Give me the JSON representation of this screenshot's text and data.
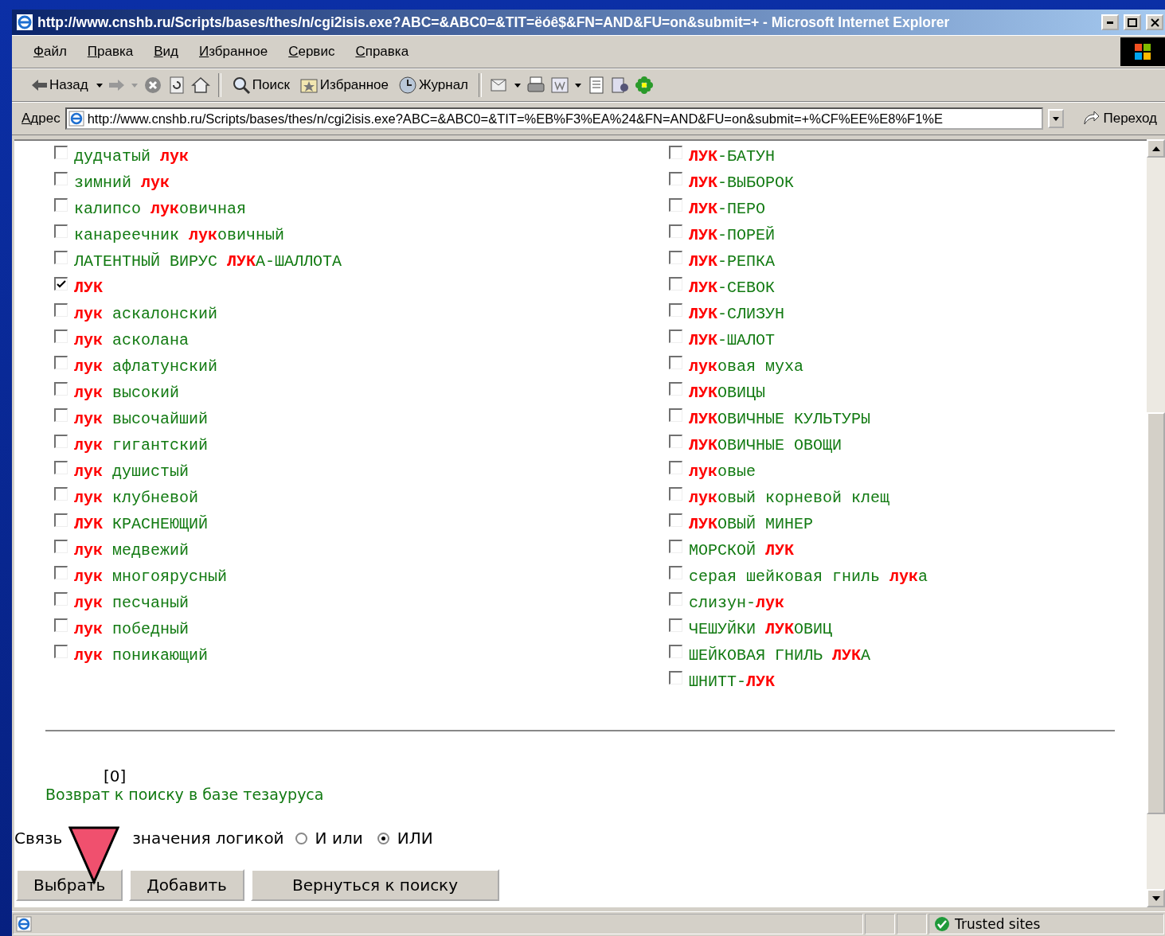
{
  "window": {
    "title": "http://www.cnshb.ru/Scripts/bases/thes/n/cgi2isis.exe?ABC=&ABC0=&TIT=ëóê$&FN=AND&FU=on&submit=+ - Microsoft Internet Explorer"
  },
  "menu": [
    "Файл",
    "Правка",
    "Вид",
    "Избранное",
    "Сервис",
    "Справка"
  ],
  "toolbar": {
    "back": "Назад",
    "buttons": [
      {
        "kind": "search",
        "label": "Поиск"
      },
      {
        "kind": "favorites",
        "label": "Избранное"
      },
      {
        "kind": "history",
        "label": "Журнал"
      }
    ]
  },
  "address": {
    "label": "Адрес",
    "url": "http://www.cnshb.ru/Scripts/bases/thes/n/cgi2isis.exe?ABC=&ABC0=&TIT=%EB%F3%EA%24&FN=AND&FU=on&submit=+%CF%EE%E8%F1%E",
    "go": "Переход"
  },
  "terms": {
    "columns": [
      [
        {
          "text": "дудчатый **лук**",
          "checked": false
        },
        {
          "text": "зимний **лук**",
          "checked": false
        },
        {
          "text": "калипсо **лук**овичная",
          "checked": false
        },
        {
          "text": "канареечник **лук**овичный",
          "checked": false
        },
        {
          "text": "ЛАТЕНТНЫЙ ВИРУС **ЛУК**А-ШАЛЛОТА",
          "checked": false
        },
        {
          "text": "**ЛУК**",
          "checked": true
        },
        {
          "text": "**лук** аскалонский",
          "checked": false
        },
        {
          "text": "**лук** асколана",
          "checked": false
        },
        {
          "text": "**лук** афлатунский",
          "checked": false
        },
        {
          "text": "**лук** высокий",
          "checked": false
        },
        {
          "text": "**лук** высочайший",
          "checked": false
        },
        {
          "text": "**лук** гигантский",
          "checked": false
        },
        {
          "text": "**лук** душистый",
          "checked": false
        },
        {
          "text": "**лук** клубневой",
          "checked": false
        },
        {
          "text": "**ЛУК** КРАСНЕЮЩИЙ",
          "checked": false
        },
        {
          "text": "**лук** медвежий",
          "checked": false
        },
        {
          "text": "**лук** многоярусный",
          "checked": false
        },
        {
          "text": "**лук** песчаный",
          "checked": false
        },
        {
          "text": "**лук** победный",
          "checked": false
        },
        {
          "text": "**лук** поникающий",
          "checked": false
        }
      ],
      [
        {
          "text": "**ЛУК**-БАТУН",
          "checked": false
        },
        {
          "text": "**ЛУК**-ВЫБОРОК",
          "checked": false
        },
        {
          "text": "**ЛУК**-ПЕРО",
          "checked": false
        },
        {
          "text": "**ЛУК**-ПОРЕЙ",
          "checked": false
        },
        {
          "text": "**ЛУК**-РЕПКА",
          "checked": false
        },
        {
          "text": "**ЛУК**-СЕВОК",
          "checked": false
        },
        {
          "text": "**ЛУК**-СЛИЗУН",
          "checked": false
        },
        {
          "text": "**ЛУК**-ШАЛОТ",
          "checked": false
        },
        {
          "text": "**лук**овая муха",
          "checked": false
        },
        {
          "text": "**ЛУК**ОВИЦЫ",
          "checked": false
        },
        {
          "text": "**ЛУК**ОВИЧНЫЕ КУЛЬТУРЫ",
          "checked": false
        },
        {
          "text": "**ЛУК**ОВИЧНЫЕ ОВОЩИ",
          "checked": false
        },
        {
          "text": "**лук**овые",
          "checked": false
        },
        {
          "text": "**лук**овый корневой клещ",
          "checked": false
        },
        {
          "text": "**ЛУК**ОВЫЙ МИНЕР",
          "checked": false
        },
        {
          "text": "МОРСКОЙ **ЛУК**",
          "checked": false
        },
        {
          "text": "серая шейковая гниль **лук**а",
          "checked": false
        },
        {
          "text": "слизун-**лук**",
          "checked": false
        },
        {
          "text": "ЧЕШУЙКИ **ЛУК**ОВИЦ",
          "checked": false
        },
        {
          "text": "ШЕЙКОВАЯ ГНИЛЬ **ЛУК**А",
          "checked": false
        },
        {
          "text": "ШНИТТ-**ЛУК**",
          "checked": false
        }
      ]
    ]
  },
  "count": "[0]",
  "return_link": "Возврат к поиску в базе тезауруса",
  "logic": {
    "label_start": "Связь",
    "label_end": "значения логикой",
    "options": [
      {
        "label": "И или",
        "selected": false
      },
      {
        "label": "ИЛИ",
        "selected": true
      }
    ]
  },
  "buttons": [
    "Выбрать",
    "Добавить",
    "Вернуться к поиску"
  ],
  "status_bar": {
    "zone": "Trusted sites"
  }
}
